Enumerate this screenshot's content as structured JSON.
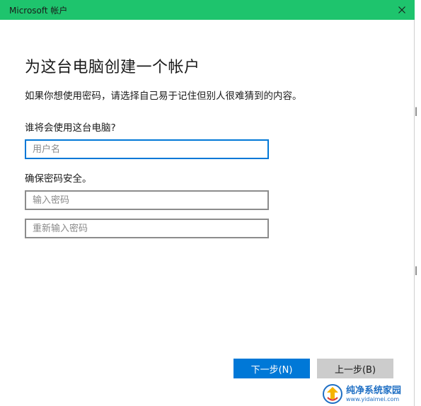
{
  "window": {
    "title": "Microsoft 帐户",
    "close_icon": "close-icon"
  },
  "heading": "为这台电脑创建一个帐户",
  "description": "如果你想使用密码，请选择自己易于记住但别人很难猜到的内容。",
  "user_section": {
    "label": "谁将会使用这台电脑?",
    "username_placeholder": "用户名"
  },
  "password_section": {
    "label": "确保密码安全。",
    "password_placeholder": "输入密码",
    "confirm_placeholder": "重新输入密码"
  },
  "buttons": {
    "next": "下一步(N)",
    "back": "上一步(B)"
  },
  "watermark": {
    "name": "纯净系统家园",
    "url": "www.yidaimei.com"
  },
  "colors": {
    "titlebar": "#1ec46d",
    "accent": "#0078d7",
    "secondary_button": "#cccccc"
  }
}
